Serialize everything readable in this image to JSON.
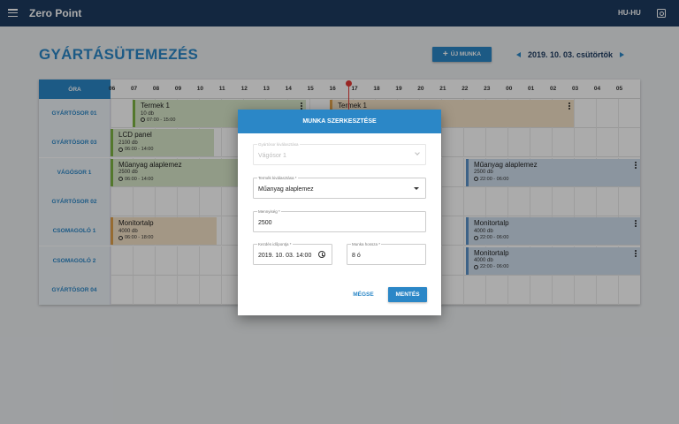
{
  "app": {
    "title": "Zero Point",
    "lang": "HU-HU"
  },
  "icons": {
    "menu": "menu-icon",
    "account": "account-box-icon",
    "clock": "clock-icon",
    "more": "kebab-icon"
  },
  "colors": {
    "header": "#1d3b60",
    "accent": "#2b87c7",
    "now_line": "#e53935"
  },
  "page": {
    "title": "GYÁRTÁSÜTEMEZÉS",
    "new_job_label": "ÚJ MUNKA",
    "date": "2019. 10. 03. csütörtök"
  },
  "schedule": {
    "hour_header": "ÓRA",
    "hours": [
      "06",
      "07",
      "08",
      "09",
      "10",
      "11",
      "12",
      "13",
      "14",
      "15",
      "16",
      "17",
      "18",
      "19",
      "20",
      "21",
      "22",
      "23",
      "00",
      "01",
      "02",
      "03",
      "04",
      "05"
    ],
    "rows": [
      {
        "label": "GYÁRTÓSOR 01"
      },
      {
        "label": "GYÁRTÓSOR 03"
      },
      {
        "label": "VÁGÓSOR 1"
      },
      {
        "label": "GYÁRTÓSOR 02"
      },
      {
        "label": "CSOMAGOLÓ 1"
      },
      {
        "label": "CSOMAGOLÓ 2"
      },
      {
        "label": "GYÁRTÓSOR 04"
      }
    ],
    "jobs": [
      {
        "row": 0,
        "name": "Termek 1",
        "qty": "10 db",
        "time": "07:00 - 15:00",
        "color": "green",
        "more": true
      },
      {
        "row": 0,
        "name": "Termek 1",
        "qty": "",
        "time": "",
        "color": "orange",
        "more": true
      },
      {
        "row": 1,
        "name": "LCD panel",
        "qty": "2100 db",
        "time": "06:00 - 14:00",
        "color": "green",
        "more": false
      },
      {
        "row": 2,
        "name": "Műanyag alaplemez",
        "qty": "2500 db",
        "time": "06:00 - 14:00",
        "color": "green",
        "more": false
      },
      {
        "row": 2,
        "name": "Műanyag alaplemez",
        "qty": "2500 db",
        "time": "22:00 - 06:00",
        "color": "blue",
        "more": true
      },
      {
        "row": 4,
        "name": "Monitortalp",
        "qty": "4000 db",
        "time": "06:00 - 18:00",
        "color": "orange",
        "more": false
      },
      {
        "row": 4,
        "name": "Monitortalp",
        "qty": "4000 db",
        "time": "22:00 - 06:00",
        "color": "blue",
        "more": true
      },
      {
        "row": 5,
        "name": "Monitortalp",
        "qty": "4000 db",
        "time": "22:00 - 06:00",
        "color": "blue",
        "more": true
      }
    ]
  },
  "dialog": {
    "title": "MUNKA SZERKESZTÉSE",
    "line_label": "Gyártósor kiválasztása",
    "line_value": "Vágósor 1",
    "product_label": "Termék kiválasztása *",
    "product_value": "Műanyag alaplemez",
    "qty_label": "Mennyiség *",
    "qty_value": "2500",
    "start_label": "Kezdés időpontja *",
    "start_value": "2019. 10. 03. 14:00",
    "length_label": "Munka hossza *",
    "length_value": "8 ó",
    "cancel_label": "MÉGSE",
    "save_label": "MENTÉS"
  }
}
